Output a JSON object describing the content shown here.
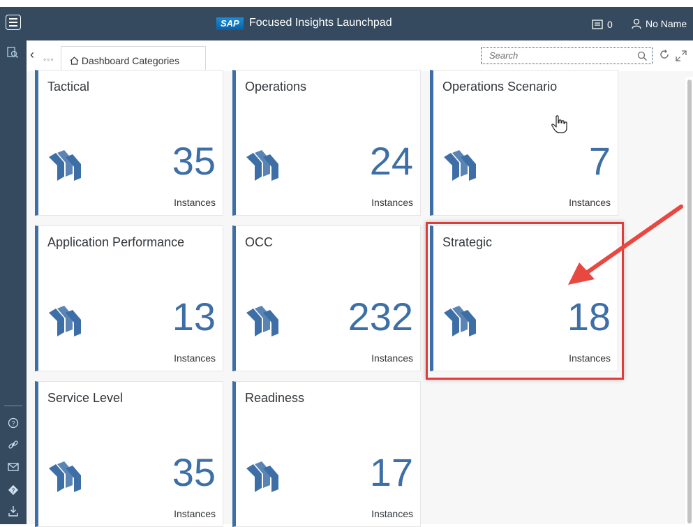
{
  "header": {
    "logo": "SAP",
    "title": "Focused Insights Launchpad",
    "notifications_count": "0",
    "user_name": "No Name"
  },
  "nav": {
    "more": "◦◦◦",
    "breadcrumb_label": "Dashboard Categories",
    "search_placeholder": "Search"
  },
  "tiles": [
    {
      "title": "Tactical",
      "count": "35",
      "unit": "Instances"
    },
    {
      "title": "Operations",
      "count": "24",
      "unit": "Instances"
    },
    {
      "title": "Operations Scenario",
      "count": "7",
      "unit": "Instances"
    },
    {
      "title": "Application Performance",
      "count": "13",
      "unit": "Instances"
    },
    {
      "title": "OCC",
      "count": "232",
      "unit": "Instances"
    },
    {
      "title": "Strategic",
      "count": "18",
      "unit": "Instances"
    },
    {
      "title": "Service Level",
      "count": "35",
      "unit": "Instances"
    },
    {
      "title": "Readiness",
      "count": "17",
      "unit": "Instances"
    }
  ],
  "colors": {
    "shell": "#354a5f",
    "accent": "#3d6fa6",
    "highlight": "#e03c3c"
  },
  "icons": {
    "menu": "hamburger-menu-icon",
    "notifications": "notifications-icon",
    "user": "person-icon",
    "tile": "tiles-stack-icon"
  }
}
